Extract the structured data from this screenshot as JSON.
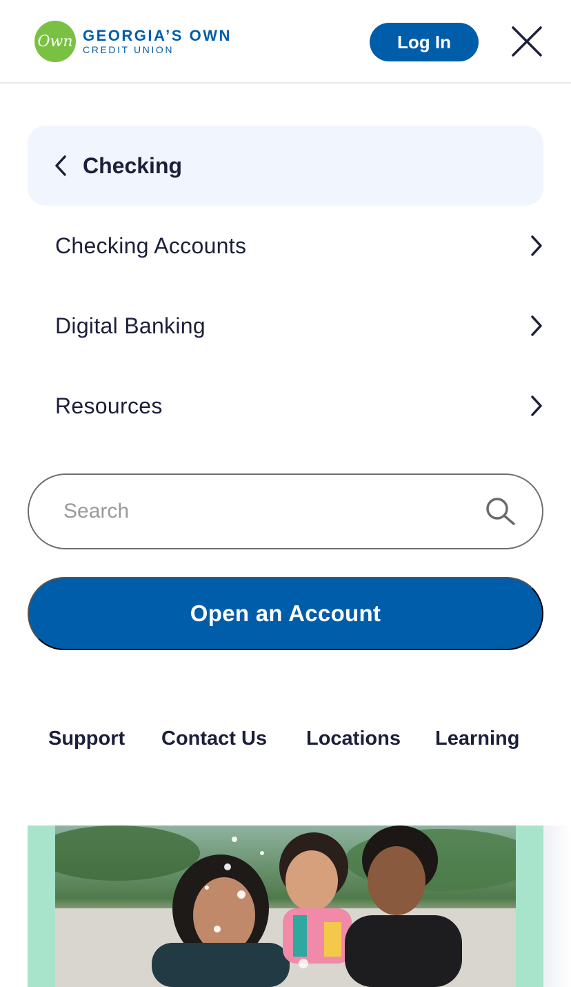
{
  "header": {
    "logo": {
      "mark_text": "Own",
      "line1": "GEORGIA’S OWN",
      "line2": "CREDIT UNION"
    },
    "login_label": "Log In"
  },
  "nav": {
    "back_label": "Checking",
    "items": [
      {
        "label": "Checking Accounts"
      },
      {
        "label": "Digital Banking"
      },
      {
        "label": "Resources"
      }
    ]
  },
  "search": {
    "placeholder": "Search",
    "value": ""
  },
  "cta": {
    "open_account_label": "Open an Account"
  },
  "footer_links": [
    {
      "label": "Support"
    },
    {
      "label": "Contact Us"
    },
    {
      "label": "Locations"
    },
    {
      "label": "Learning"
    }
  ],
  "colors": {
    "brand_blue": "#005daa",
    "brand_green": "#7ac143",
    "text_dark": "#1b1f3b",
    "back_row_bg": "#f1f6fe",
    "promo_bg": "#a8e3cb"
  },
  "icons": {
    "close": "close-icon",
    "back": "chevron-left-icon",
    "forward": "chevron-right-icon",
    "search": "search-icon"
  }
}
